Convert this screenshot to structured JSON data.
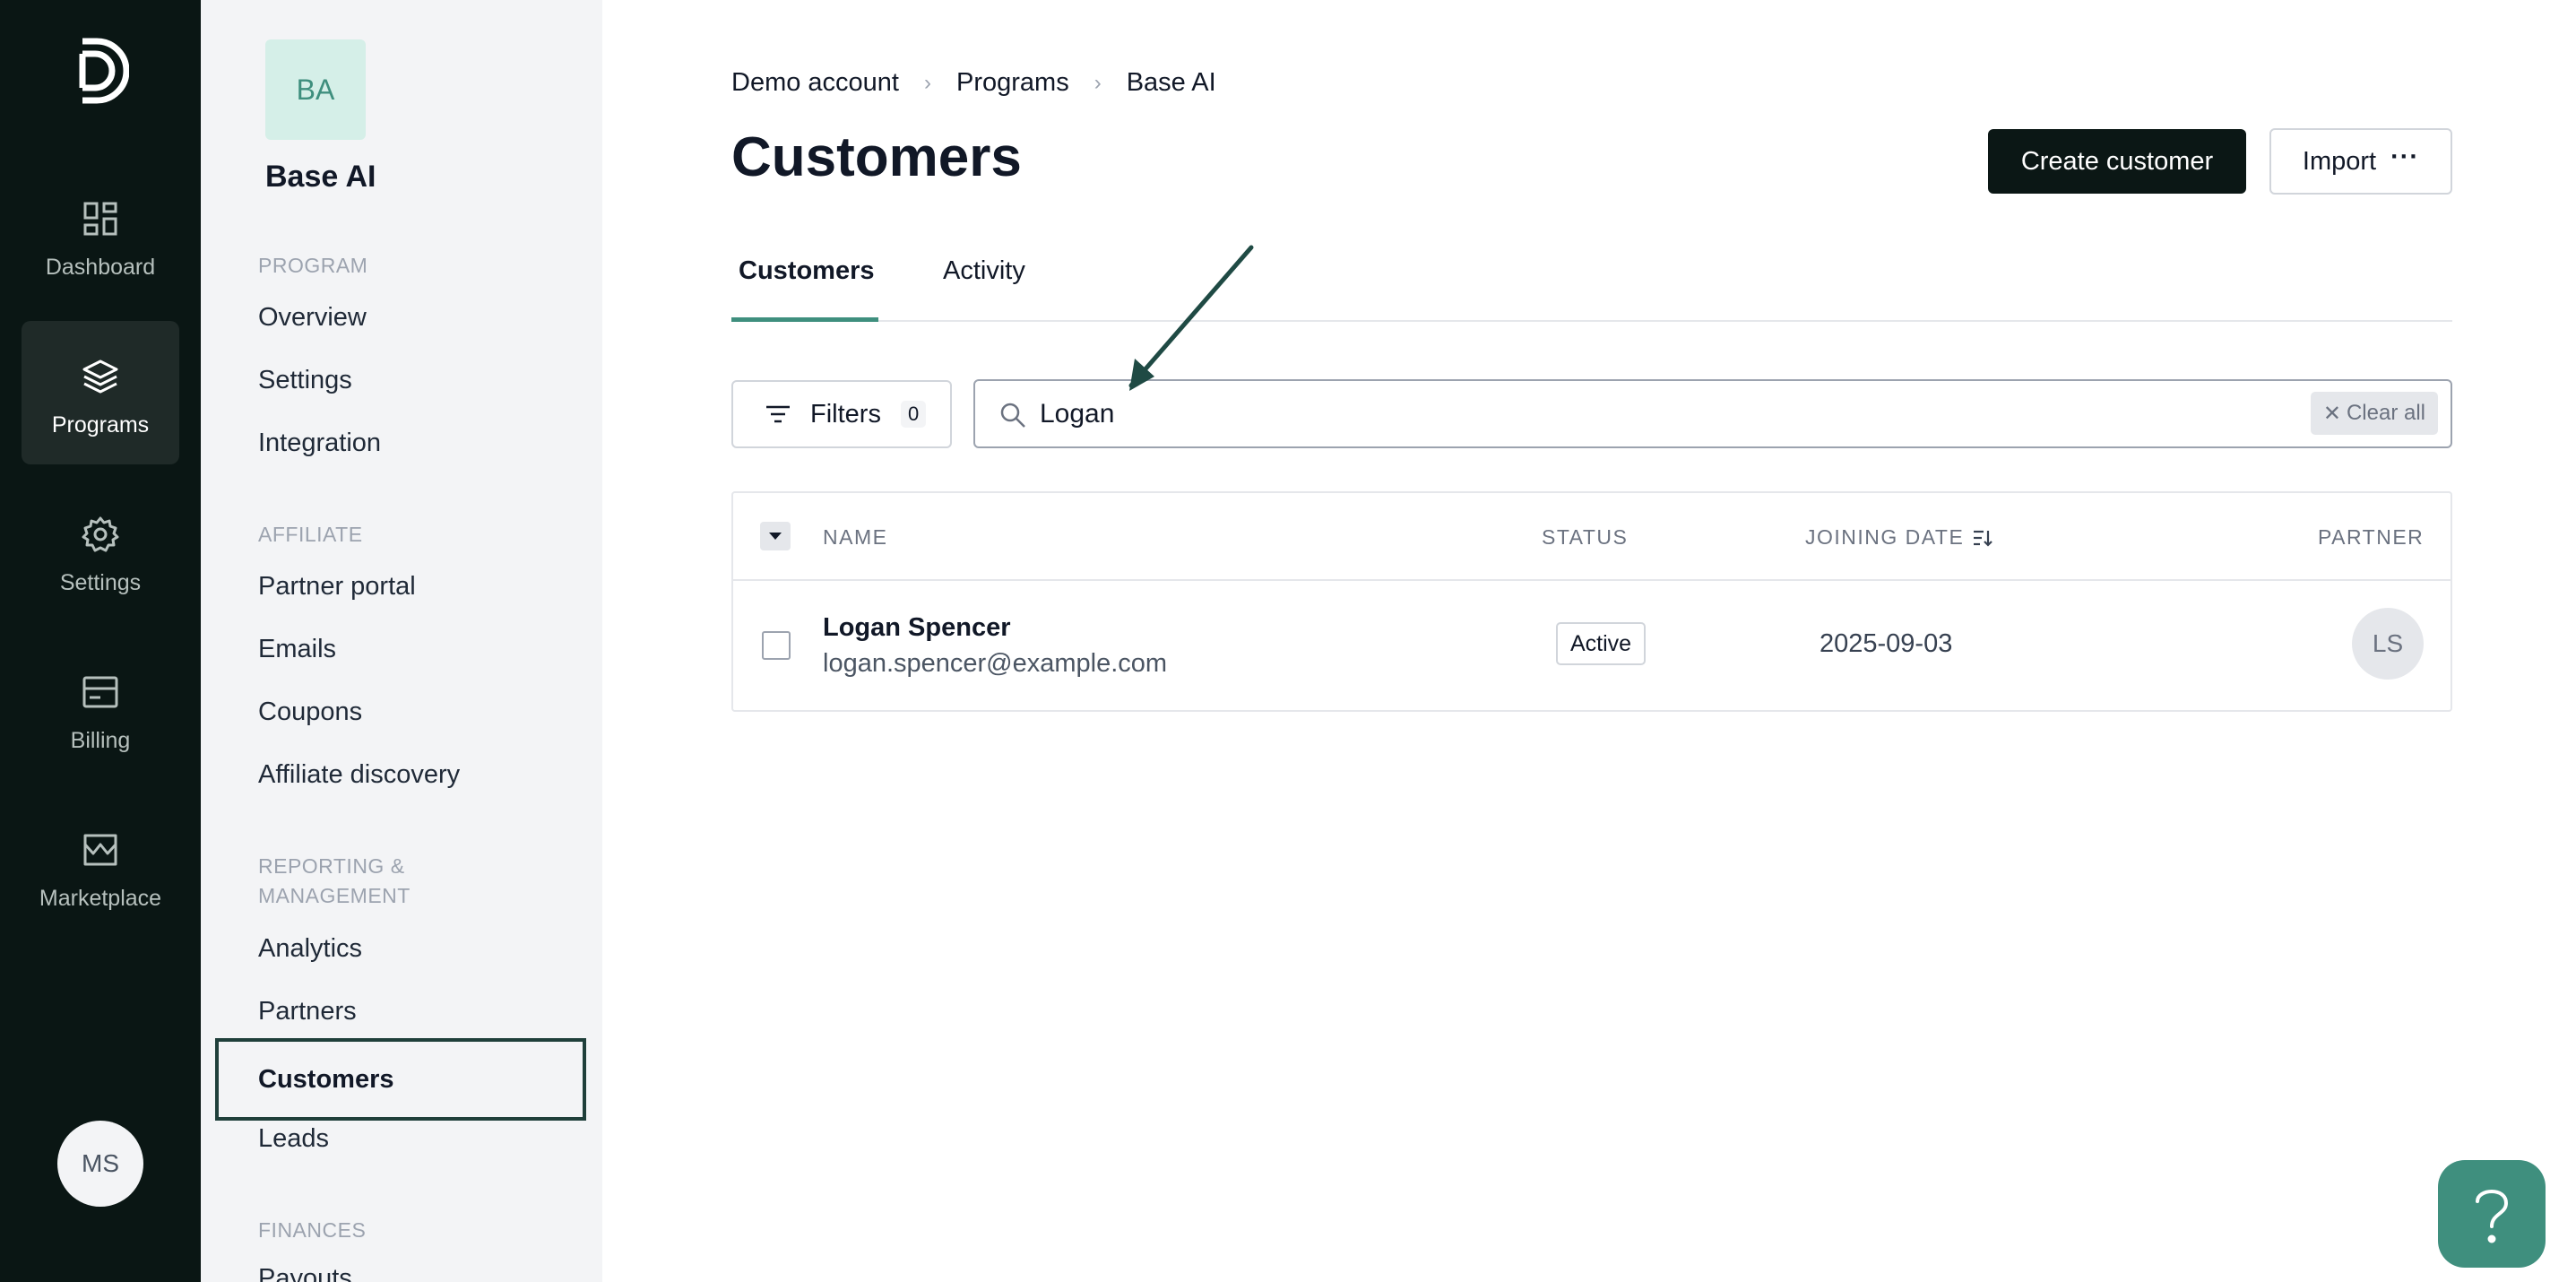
{
  "rail": {
    "items": [
      {
        "label": "Dashboard",
        "icon": "dashboard-icon"
      },
      {
        "label": "Programs",
        "icon": "layers-icon"
      },
      {
        "label": "Settings",
        "icon": "gear-icon"
      },
      {
        "label": "Billing",
        "icon": "billing-icon"
      },
      {
        "label": "Marketplace",
        "icon": "store-icon"
      }
    ],
    "active": "Programs",
    "user_initials": "MS"
  },
  "sidebar": {
    "program_initials": "BA",
    "program_name": "Base AI",
    "sections": [
      {
        "heading": "PROGRAM",
        "items": [
          "Overview",
          "Settings",
          "Integration"
        ]
      },
      {
        "heading": "AFFILIATE",
        "items": [
          "Partner portal",
          "Emails",
          "Coupons",
          "Affiliate discovery"
        ]
      },
      {
        "heading": "REPORTING & MANAGEMENT",
        "items": [
          "Analytics",
          "Partners",
          "Customers",
          "Leads"
        ]
      },
      {
        "heading": "FINANCES",
        "items": [
          "Payouts"
        ]
      }
    ],
    "active_item": "Customers"
  },
  "breadcrumb": [
    "Demo account",
    "Programs",
    "Base AI"
  ],
  "page_title": "Customers",
  "actions": {
    "create_label": "Create customer",
    "import_label": "Import",
    "import_more": "···"
  },
  "tabs": [
    "Customers",
    "Activity"
  ],
  "active_tab": "Customers",
  "filters": {
    "label": "Filters",
    "count": "0"
  },
  "search": {
    "value": "Logan",
    "clear_label": "Clear all"
  },
  "table": {
    "columns": [
      "NAME",
      "STATUS",
      "JOINING DATE",
      "PARTNER"
    ],
    "rows": [
      {
        "name": "Logan Spencer",
        "email": "logan.spencer@example.com",
        "status": "Active",
        "joining_date": "2025-09-03",
        "partner_initials": "LS"
      }
    ]
  },
  "help": {
    "label": "?"
  },
  "colors": {
    "accent": "#3f8f7e",
    "rail_bg": "#0a1614",
    "primary_button": "#0b1715"
  }
}
